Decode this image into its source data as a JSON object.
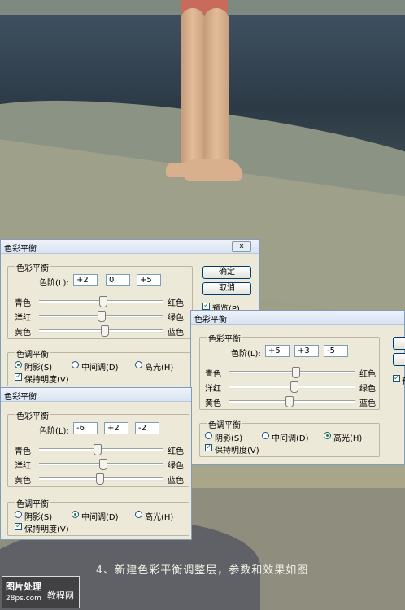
{
  "caption": "4、新建色彩平衡调整层，参数和效果如图",
  "logo": {
    "line1": "图片处理",
    "line2": "28ps.com",
    "watermark": "教程网"
  },
  "dialog_common": {
    "title": "色彩平衡",
    "close": "ⅹ",
    "group_balance": "色彩平衡",
    "levels_label": "色阶(L):",
    "cyan": "青色",
    "red": "红色",
    "magenta": "洋红",
    "green": "绿色",
    "yellow": "黄色",
    "blue": "蓝色",
    "group_tone": "色调平衡",
    "shadows": "阴影(S)",
    "midtones": "中间调(D)",
    "highlights": "高光(H)",
    "preserve": "保持明度(V)",
    "ok": "确定",
    "cancel": "取消",
    "preview": "预览(P)",
    "preview_short": "预"
  },
  "dialogs": [
    {
      "levels": [
        "+2",
        "0",
        "+5"
      ],
      "tone": "shadows"
    },
    {
      "levels": [
        "+5",
        "+3",
        "-5"
      ],
      "tone": "highlights"
    },
    {
      "levels": [
        "-6",
        "+2",
        "-2"
      ],
      "tone": "midtones"
    }
  ],
  "slider_range": [
    -100,
    100
  ]
}
